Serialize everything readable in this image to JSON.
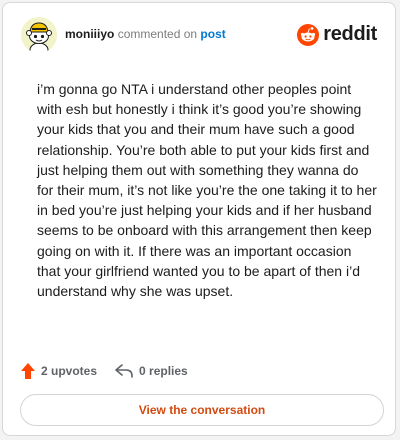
{
  "comment": {
    "username": "moniiiyo",
    "action_text": "commented on",
    "target_text": "post",
    "body": "i’m gonna go NTA i understand other peoples point with esh but honestly i think it’s good you’re showing your kids that you and their mum have such a good relationship. You’re both able to put your kids first and just helping them out with something they wanna do for their mum, it’s not like you’re the one taking it to her in bed you’re just helping your kids and if her husband seems to be onboard with this arrangement then keep going on with it. If there was an important occasion that your girlfriend wanted you to be apart of then i’d understand why she was upset."
  },
  "brand": {
    "wordmark": "reddit",
    "accent": "#ff4500"
  },
  "stats": {
    "upvotes": "2 upvotes",
    "replies": "0 replies"
  },
  "cta": {
    "label": "View the conversation",
    "color": "#d34a0f"
  },
  "icons": {
    "avatar": "snoo-avatar",
    "logo": "reddit-alien-icon",
    "upvote": "upvote-arrow-icon",
    "reply": "reply-arrow-icon"
  }
}
